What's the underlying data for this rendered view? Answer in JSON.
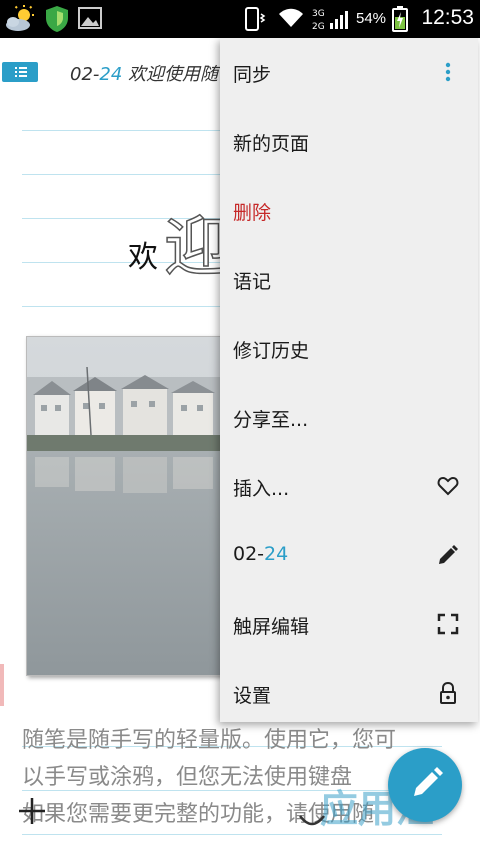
{
  "status_bar": {
    "battery_percent": "54%",
    "time": "12:53",
    "network_labels": [
      "3G",
      "2G"
    ]
  },
  "note": {
    "title_prefix": "02-",
    "title_number": "24",
    "title_rest": " 欢迎使用随",
    "handwriting_small": "欢",
    "handwriting_large": "迎",
    "body_lines": [
      "随笔是随手写的轻量版。使用它，您可",
      "以手写或涂鸦，但您无法使用键盘",
      "如果您需要更完整的功能，请使用随"
    ]
  },
  "menu": {
    "items": [
      {
        "label": "同步",
        "icon": "more-vert-icon"
      },
      {
        "label": "新的页面",
        "icon": ""
      },
      {
        "label": "删除",
        "icon": "",
        "color": "#c62828"
      },
      {
        "label": "语记",
        "icon": ""
      },
      {
        "label": "修订历史",
        "icon": ""
      },
      {
        "label": "分享至...",
        "icon": ""
      },
      {
        "label": "插入...",
        "icon": "heart-outline-icon"
      },
      {
        "label_prefix": "02-",
        "label_number": "24",
        "icon": "pencil-icon"
      },
      {
        "label": "触屏编辑",
        "icon": "fullscreen-icon"
      },
      {
        "label": "设置",
        "icon": "lock-icon"
      }
    ]
  },
  "watermark": "应用汇",
  "colors": {
    "accent": "#2b9ec8",
    "rule_line": "#bfe3ef",
    "danger": "#c62828",
    "menu_bg": "#efefef"
  }
}
